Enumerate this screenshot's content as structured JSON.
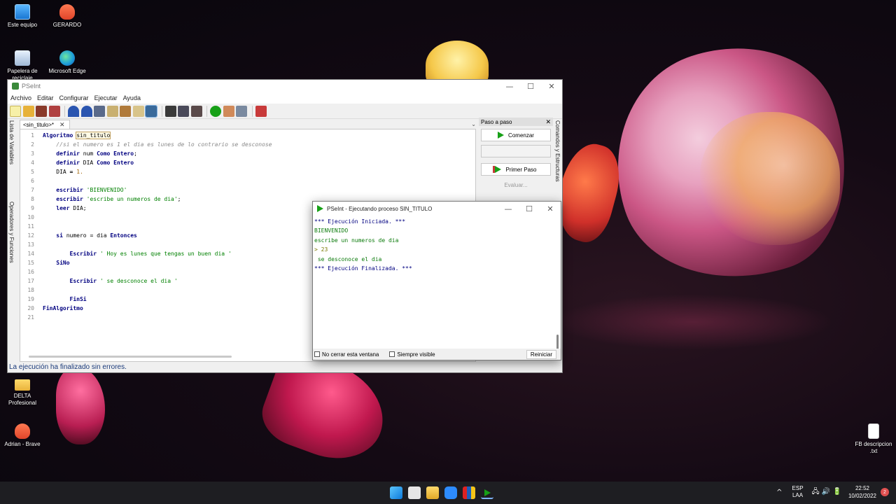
{
  "desktop": {
    "icons": [
      {
        "label": "Este equipo"
      },
      {
        "label": "GERARDO"
      },
      {
        "label": "Papelera de reciclaje"
      },
      {
        "label": "Microsoft Edge"
      },
      {
        "label": "DELTA Profesional"
      },
      {
        "label": "Adrian - Brave"
      },
      {
        "label": "FB descripcion .txt"
      }
    ]
  },
  "main_window": {
    "title": "PSeInt",
    "controls": {
      "minimize": "—",
      "maximize": "☐",
      "close": "✕"
    },
    "menu": [
      "Archivo",
      "Editar",
      "Configurar",
      "Ejecutar",
      "Ayuda"
    ],
    "side_tabs": {
      "variables": "Lista de Variables",
      "operators": "Operadores y Funciones"
    },
    "tab": {
      "label": "<sin_titulo>*",
      "close": "✕"
    },
    "code": [
      {
        "n": "1",
        "text": "Algoritmo sin_titulo"
      },
      {
        "n": "2",
        "text": "    //si el numero es 1 el dia es lunes de lo contrario se desconose"
      },
      {
        "n": "3",
        "text": "    definir num Como Entero;"
      },
      {
        "n": "4",
        "text": "    definir DIA Como Entero"
      },
      {
        "n": "5",
        "text": "    DIA = 1."
      },
      {
        "n": "6",
        "text": ""
      },
      {
        "n": "7",
        "text": "    escribir 'BIENVENIDO'"
      },
      {
        "n": "8",
        "text": "    escribir 'escribe un numeros de dia';"
      },
      {
        "n": "9",
        "text": "    leer DIA;"
      },
      {
        "n": "10",
        "text": ""
      },
      {
        "n": "11",
        "text": ""
      },
      {
        "n": "12",
        "text": "    si numero = dia Entonces"
      },
      {
        "n": "13",
        "text": ""
      },
      {
        "n": "14",
        "text": "        Escribir ' Hoy es lunes que tengas un buen dia '"
      },
      {
        "n": "15",
        "text": "    SiNo"
      },
      {
        "n": "16",
        "text": ""
      },
      {
        "n": "17",
        "text": "        Escribir ' se desconoce el dia '"
      },
      {
        "n": "18",
        "text": ""
      },
      {
        "n": "19",
        "text": "        FinSi"
      },
      {
        "n": "20",
        "text": "FinAlgoritmo"
      },
      {
        "n": "21",
        "text": ""
      }
    ],
    "status": "La ejecución ha finalizado sin errores.",
    "paso_panel": {
      "title": "Paso a paso",
      "close": "✕",
      "comenzar": "Comenzar",
      "primer_paso": "Primer Paso",
      "evaluar": "Evaluar..."
    },
    "right_tab": "Comandos y Estructuras"
  },
  "exec_window": {
    "title": "PSeInt - Ejecutando proceso SIN_TITULO",
    "controls": {
      "minimize": "—",
      "maximize": "☐",
      "close": "✕"
    },
    "output": [
      {
        "kind": "sys",
        "text": "*** Ejecución Iniciada. ***"
      },
      {
        "kind": "out",
        "text": "BIENVENIDO"
      },
      {
        "kind": "out",
        "text": "escribe un numeros de dia"
      },
      {
        "kind": "inp",
        "text": "> 23"
      },
      {
        "kind": "out",
        "text": " se desconoce el dia"
      },
      {
        "kind": "sys",
        "text": "*** Ejecución Finalizada. ***"
      }
    ],
    "no_cerrar": "No cerrar esta ventana",
    "siempre_visible": "Siempre visible",
    "reiniciar": "Reiniciar"
  },
  "taskbar": {
    "lang_top": "ESP",
    "lang_bottom": "LAA",
    "time": "22:52",
    "date": "10/02/2022",
    "notifications": "2",
    "tray_chevron": "^",
    "tray_icons": "🖧 🔊 🔋"
  }
}
